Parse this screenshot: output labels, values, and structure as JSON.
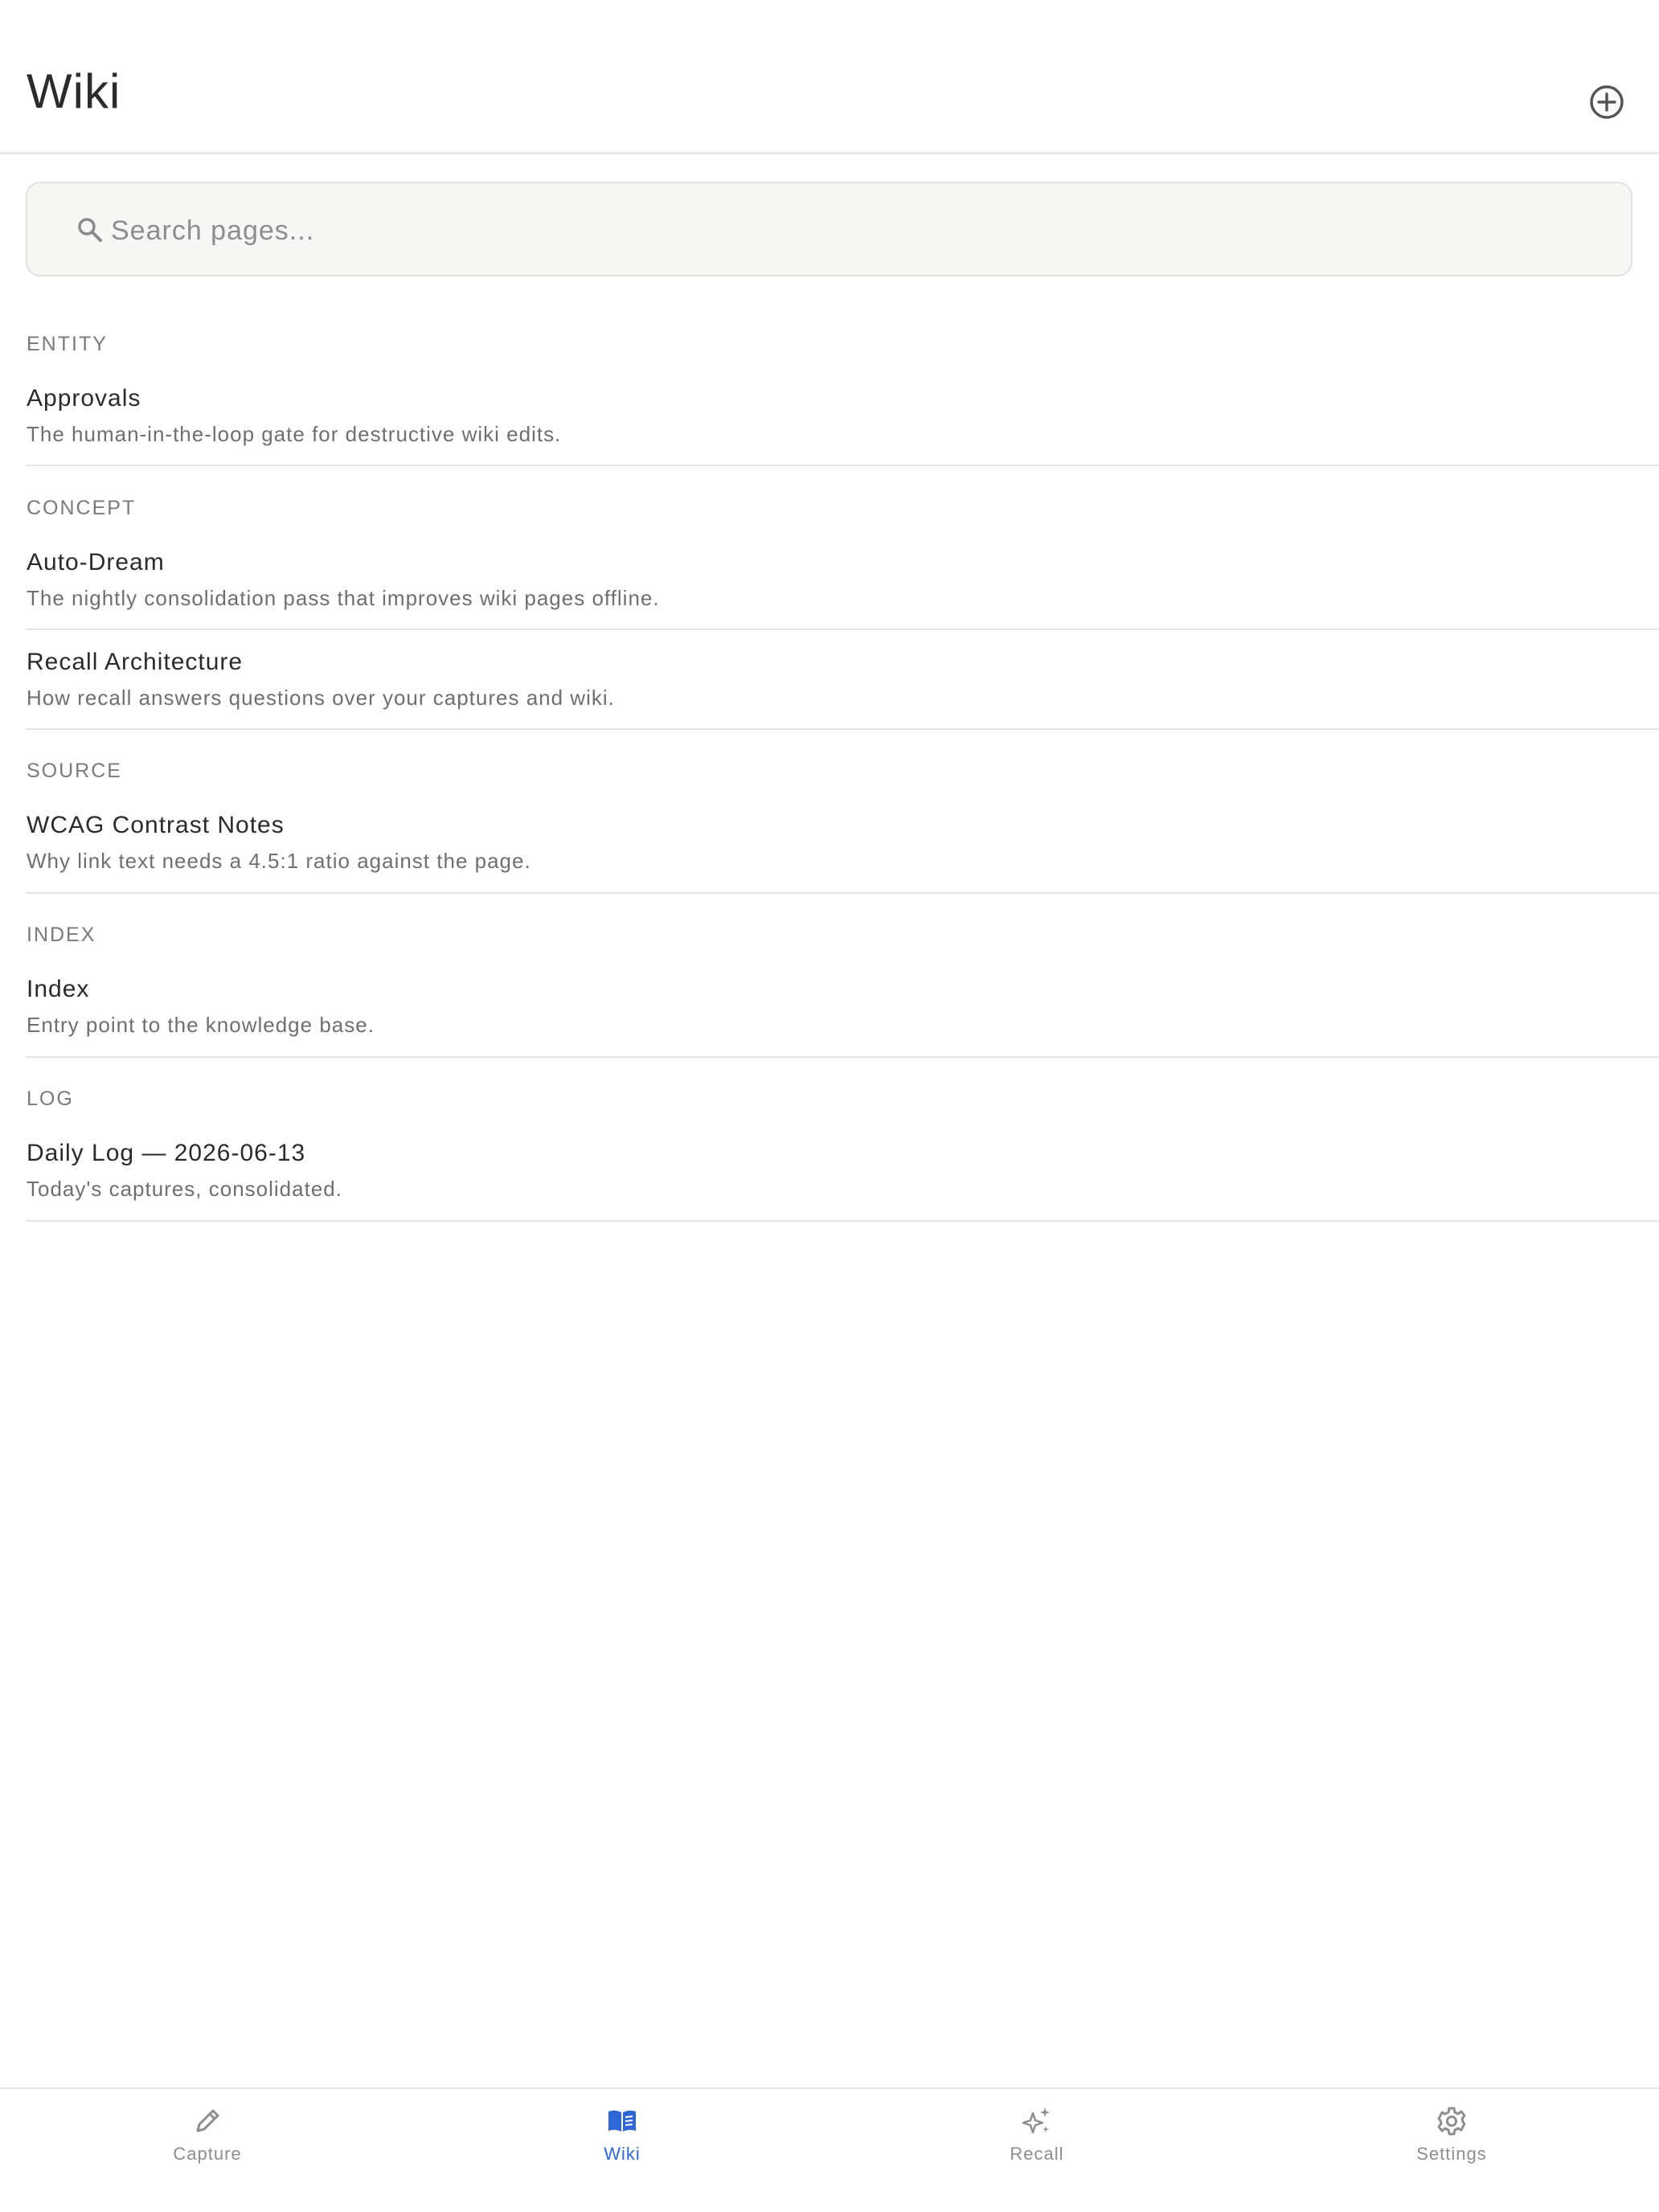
{
  "header": {
    "title": "Wiki",
    "add_icon": "plus-circle-icon"
  },
  "search": {
    "placeholder": "Search pages...",
    "value": "",
    "icon": "search-icon"
  },
  "groups": [
    {
      "label": "ENTITY",
      "items": [
        {
          "title": "Approvals",
          "description": "The human-in-the-loop gate for destructive wiki edits."
        }
      ]
    },
    {
      "label": "CONCEPT",
      "items": [
        {
          "title": "Auto-Dream",
          "description": "The nightly consolidation pass that improves wiki pages offline."
        },
        {
          "title": "Recall Architecture",
          "description": "How recall answers questions over your captures and wiki."
        }
      ]
    },
    {
      "label": "SOURCE",
      "items": [
        {
          "title": "WCAG Contrast Notes",
          "description": "Why link text needs a 4.5:1 ratio against the page."
        }
      ]
    },
    {
      "label": "INDEX",
      "items": [
        {
          "title": "Index",
          "description": "Entry point to the knowledge base."
        }
      ]
    },
    {
      "label": "LOG",
      "items": [
        {
          "title": "Daily Log — 2026-06-13",
          "description": "Today's captures, consolidated."
        }
      ]
    }
  ],
  "tabs": [
    {
      "label": "Capture",
      "icon": "pencil-icon",
      "active": false
    },
    {
      "label": "Wiki",
      "icon": "book-icon",
      "active": true
    },
    {
      "label": "Recall",
      "icon": "sparkles-icon",
      "active": false
    },
    {
      "label": "Settings",
      "icon": "gear-icon",
      "active": false
    }
  ],
  "colors": {
    "accent": "#2f67d8",
    "text": "#2b2b2b",
    "muted": "#6f6f6f",
    "divider": "#e4e4e4",
    "search_bg": "#f6f6f4"
  }
}
